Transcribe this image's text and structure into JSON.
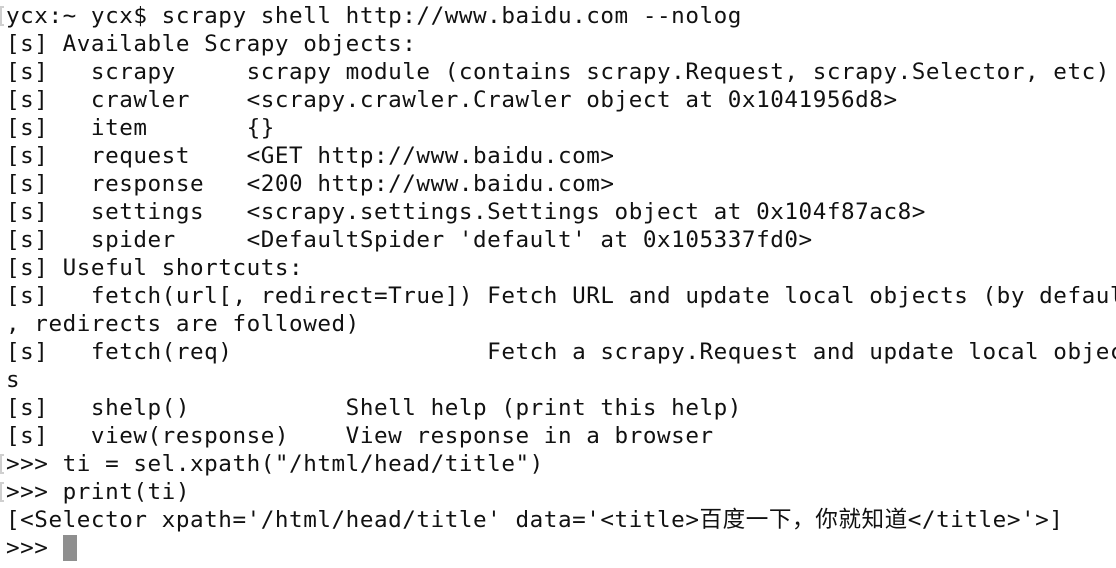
{
  "terminal": {
    "lines": [
      "ycx:~ ycx$ scrapy shell http://www.baidu.com --nolog",
      "[s] Available Scrapy objects:",
      "[s]   scrapy     scrapy module (contains scrapy.Request, scrapy.Selector, etc)",
      "[s]   crawler    <scrapy.crawler.Crawler object at 0x1041956d8>",
      "[s]   item       {}",
      "[s]   request    <GET http://www.baidu.com>",
      "[s]   response   <200 http://www.baidu.com>",
      "[s]   settings   <scrapy.settings.Settings object at 0x104f87ac8>",
      "[s]   spider     <DefaultSpider 'default' at 0x105337fd0>",
      "[s] Useful shortcuts:",
      "[s]   fetch(url[, redirect=True]) Fetch URL and update local objects (by default",
      ", redirects are followed)",
      "[s]   fetch(req)                  Fetch a scrapy.Request and update local object",
      "s",
      "[s]   shelp()           Shell help (print this help)",
      "[s]   view(response)    View response in a browser",
      ">>> ti = sel.xpath(\"/html/head/title\")",
      ">>> print(ti)",
      "[<Selector xpath='/html/head/title' data='<title>百度一下，你就知道</title>'>]",
      ">>> "
    ],
    "prompt": ">>> ",
    "cursor_color": "#8f8f8f",
    "text_color": "#111111",
    "background_color": "#ffffff"
  }
}
